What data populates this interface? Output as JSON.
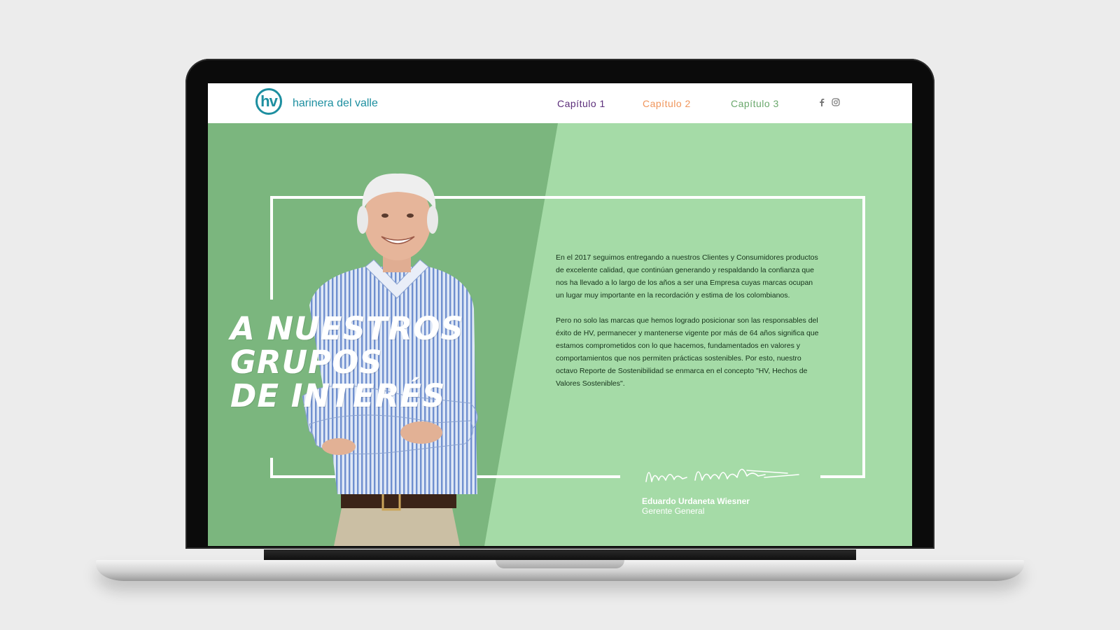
{
  "header": {
    "logo_badge": "hv",
    "logo_text": "harinera del valle",
    "nav": [
      {
        "label": "Capítulo 1",
        "color": "#5b2d7a"
      },
      {
        "label": "Capítulo 2",
        "color": "#f0955b"
      },
      {
        "label": "Capítulo 3",
        "color": "#6aa86c"
      }
    ],
    "social": [
      "facebook-icon",
      "instagram-icon"
    ]
  },
  "hero": {
    "headline": [
      "A NUESTROS",
      "GRUPOS",
      "DE INTERÉS"
    ],
    "paragraphs": [
      "En el 2017 seguimos entregando a nuestros Clientes y Consumidores productos de excelente calidad, que continúan generando y respaldando la confianza que nos ha llevado a lo largo de los años a ser una Empresa cuyas marcas ocupan un lugar muy importante en la recordación y estima de los colombianos.",
      "Pero no solo las marcas que hemos logrado posicionar son las responsables del éxito de HV, permanecer y mantenerse vigente por más de 64 años significa que estamos comprometidos con lo que hacemos, fundamentados en valores y comportamientos que nos permiten prácticas sostenibles. Por esto, nuestro octavo Reporte de Sostenibilidad se enmarca en el concepto \"HV, Hechos de Valores Sostenibles\"."
    ],
    "signer_name": "Eduardo Urdaneta Wiesner",
    "signer_role": "Gerente General"
  },
  "colors": {
    "background_light": "#a5dba7",
    "background_dark": "#7bb67e",
    "brand": "#1d8fa0"
  }
}
